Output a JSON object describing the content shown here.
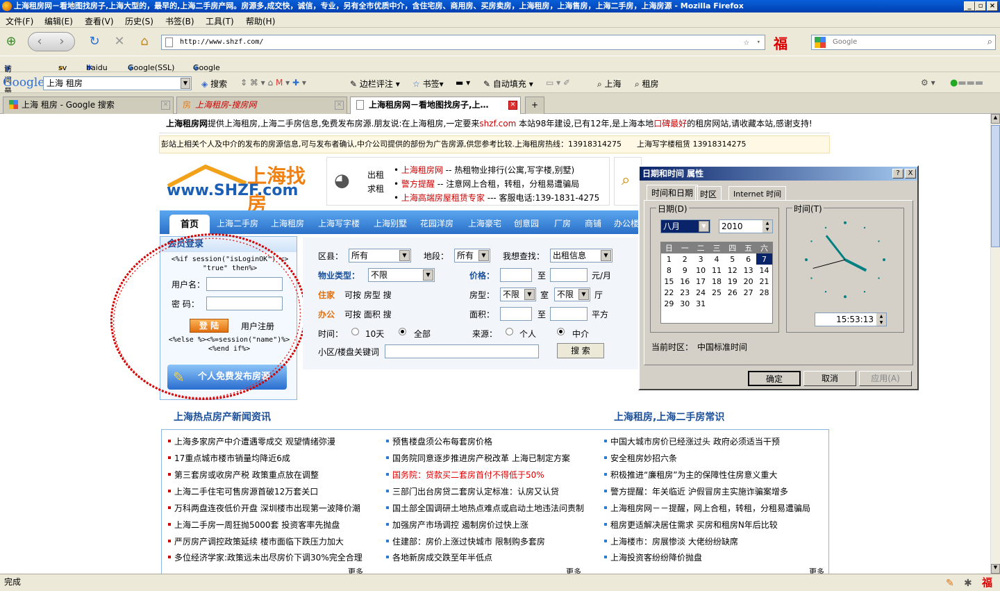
{
  "window": {
    "title": "上海租房网－看地图找房子,上海大型的，最早的,上海二手房产网。房源多,成交快，诚信，专业，另有全市优质中介，含住宅房、商用房、买房卖房，上海租房，上海售房，上海二手房，上海房源 - Mozilla Firefox"
  },
  "menu": [
    "文件(F)",
    "编辑(E)",
    "查看(V)",
    "历史(S)",
    "书签(B)",
    "工具(T)",
    "帮助(H)"
  ],
  "address": {
    "url": "http://www.shzf.com/"
  },
  "search": {
    "placeholder": "Google"
  },
  "bookmarks": [
    "访问最多",
    "sv",
    "baidu",
    "Google(SSL)",
    "Google"
  ],
  "google_toolbar": {
    "logo": "Google",
    "query": "上海 租房",
    "items": [
      "搜索",
      "边栏评注",
      "书签",
      "自动填充",
      "上海",
      "租房"
    ]
  },
  "tabs": [
    {
      "label": "上海 租房 - Google 搜索"
    },
    {
      "label": "上海租房-搜房网"
    },
    {
      "label": "上海租房网－看地图找房子,上…"
    }
  ],
  "page": {
    "intro_bold": "上海租房网",
    "intro_text": "提供上海租房,上海二手房信息,免费发布房源.朋友说:在上海租房,一定要来",
    "intro_link": "shzf.com",
    "intro_text2": " 本站98年建设,已有12年,是上海本地",
    "intro_red": "口碑最好",
    "intro_text3": "的租房网站,请收藏本站,感谢支持!",
    "notice": "彭站上相关个人及中介的发布的房源信息,可与发布者确认,中介公司提供的部份为广告房源,供您参考比较.上海租房热线：13918314275　　上海写字楼租赁 13918314275",
    "logo_cn": "上海找房",
    "logo_en": "www.SHZF.com",
    "ad_left1": "出租",
    "ad_left2": "求租",
    "ad_lines": [
      {
        "red": "上海租房网",
        "text": " -- 热租物业排行(公寓,写字楼,别墅)"
      },
      {
        "red": "警方提醒",
        "text": " -- 注意网上合租，转租，分租易遭骗局"
      },
      {
        "red": "上海高端房屋租赁专家",
        "text": " --- 客服电话:139-1831-4275"
      }
    ],
    "nav": [
      "首页",
      "上海二手房",
      "上海租房",
      "上海写字楼",
      "上海别墅",
      "花园洋房",
      "上海豪宅",
      "创意园",
      "厂房",
      "商铺",
      "办公楼"
    ],
    "login": {
      "title": "会员登录",
      "code1": "<%if session(\"isLoginOK\") <> \"true\" then%>",
      "user_label": "用户名：",
      "pass_label": "密 码：",
      "login_btn": "登 陆",
      "register": "用户注册",
      "code2": "<%else %><%=session(\"name\")%><%end if%>",
      "publish_btn": "个人免费发布房源"
    },
    "searchform": {
      "district_label": "区县：",
      "district": "所有",
      "section_label": "地段：",
      "section": "所有",
      "want_label": "我想查找：",
      "want": "出租信息",
      "ptype_label": "物业类型：",
      "ptype": "不限",
      "price_label": "价格：",
      "price_to": "至",
      "price_unit": "元/月",
      "home_label": "住家",
      "home_text": "可按 房型 搜",
      "room_label": "房型：",
      "room": "不限",
      "room_unit": "室",
      "hall": "不限",
      "hall_unit": "厅",
      "office_label": "办公",
      "office_text": "可按 面积 搜",
      "area_label": "面积：",
      "area_to": "至",
      "area_unit": "平方",
      "time_label": "时间：",
      "time_opt1": "10天",
      "time_opt2": "全部",
      "source_label": "来源：",
      "source_opt1": "个人",
      "source_opt2": "中介",
      "keyword_label": "小区/楼盘关键词",
      "search_btn": "搜 索"
    },
    "news_title": "上海热点房产新闻资讯",
    "know_title": "上海租房,上海二手房常识",
    "news_col1": [
      "上海多家房产中介遭遇零成交 观望情绪弥漫",
      "17重点城市楼市销量均降近6成",
      "第三套房或收房产税 政策重点放在调整",
      "上海二手住宅可售房源首破12万套关口",
      "万科两盘连夜低价开盘 深圳楼市出现第一波降价潮",
      "上海二手房一周狂抛5000套 投资客率先抛盘",
      "严厉房产调控政策延续 楼市面临下跌压力加大",
      "多位经济学家:政策远未出尽房价下调30%完全合理"
    ],
    "news_col2": [
      "预售楼盘须公布每套房价格",
      "国务院同意逐步推进房产税改革 上海已制定方案",
      "国务院：贷款买二套房首付不得低于50%",
      "三部门出台房贷二套房认定标准：认房又认贷",
      "国土部全国调研土地热点难点或启动土地违法问责制",
      "加强房产市场调控 遏制房价过快上涨",
      "住建部：房价上涨过快城市 限制购多套房",
      "各地新房成交跌至年半低点"
    ],
    "news_col3": [
      "中国大城市房价已经涨过头 政府必须适当干预",
      "安全租房妙招六条",
      "积极推进“廉租房”为主的保障性住房意义重大",
      "警方提醒：年关临近 沪假冒房主实施诈骗案增多",
      "上海租房网－－提醒，网上合租，转租，分租易遭骗局",
      "租房更适解决居住需求 买房和租房N年后比较",
      "上海楼市：房展惨淡 大佬纷纷缺席",
      "上海投资客纷纷降价抛盘"
    ],
    "more": "更多"
  },
  "dialog": {
    "title": "日期和时间 属性",
    "tabs": [
      "时间和日期",
      "时区",
      "Internet 时间"
    ],
    "date_label": "日期(D)",
    "time_label": "时间(T)",
    "month": "八月",
    "year": "2010",
    "weekdays": [
      "日",
      "一",
      "二",
      "三",
      "四",
      "五",
      "六"
    ],
    "days": [
      [
        "",
        "",
        "",
        "",
        "",
        "",
        "1"
      ]
    ],
    "time": "15:53:13",
    "timezone_label": "当前时区：",
    "timezone": "中国标准时间",
    "ok": "确定",
    "cancel": "取消",
    "apply": "应用(A)",
    "help": "?",
    "close": "X",
    "hour_angle": 117,
    "minute_angle": -38,
    "second_angle": 255
  },
  "calendar_rows": [
    [
      "1",
      "2",
      "3",
      "4",
      "5",
      "6",
      "7"
    ],
    [
      "8",
      "9",
      "10",
      "11",
      "12",
      "13",
      "14"
    ],
    [
      "15",
      "16",
      "17",
      "18",
      "19",
      "20",
      "21"
    ],
    [
      "22",
      "23",
      "24",
      "25",
      "26",
      "27",
      "28"
    ],
    [
      "29",
      "30",
      "31",
      "",
      "",
      "",
      ""
    ]
  ],
  "status": {
    "text": "完成"
  }
}
